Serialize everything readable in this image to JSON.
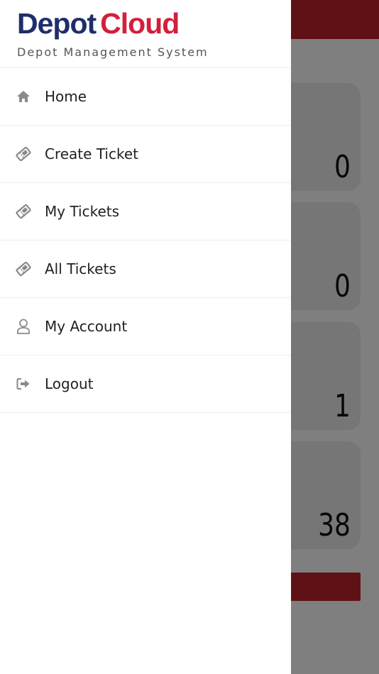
{
  "colors": {
    "brand_blue": "#1f2d6b",
    "brand_red": "#d21f3c",
    "header_red": "#c0222d",
    "icon_gray": "#8a8a8a"
  },
  "logo": {
    "part1": "Depot",
    "part2": "Cloud",
    "tagline": "Depot Management System"
  },
  "menu": {
    "items": [
      {
        "label": "Home",
        "icon": "home-icon"
      },
      {
        "label": "Create Ticket",
        "icon": "ticket-icon"
      },
      {
        "label": "My Tickets",
        "icon": "ticket-icon"
      },
      {
        "label": "All Tickets",
        "icon": "ticket-icon"
      },
      {
        "label": "My Account",
        "icon": "user-icon"
      },
      {
        "label": "Logout",
        "icon": "logout-icon"
      }
    ]
  },
  "stats": [
    {
      "value": "0"
    },
    {
      "value": "0"
    },
    {
      "value": "1"
    },
    {
      "value": "38"
    }
  ]
}
